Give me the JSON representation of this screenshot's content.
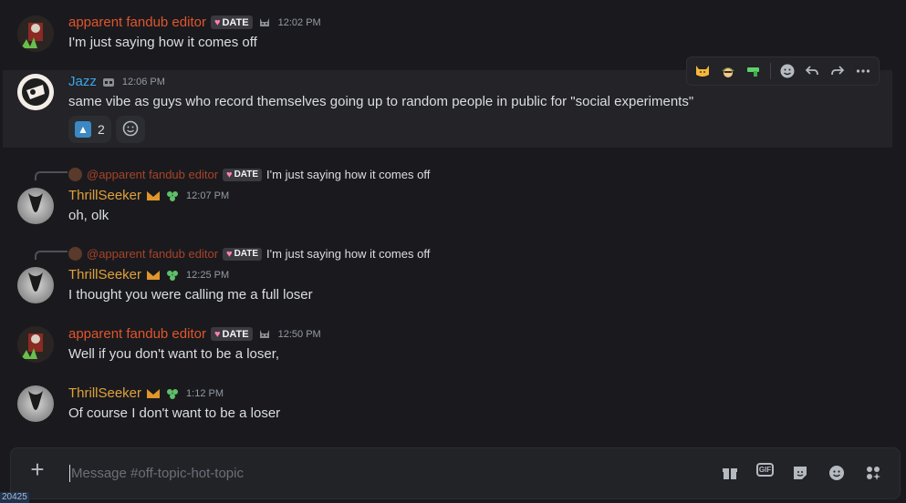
{
  "messages": [
    {
      "id": "m1",
      "author": "apparent fandub editor",
      "badge": "DATE",
      "time": "12:02 PM",
      "text": "I'm just saying how it comes off"
    },
    {
      "id": "m2",
      "author": "Jazz",
      "time": "12:06 PM",
      "text": "same vibe as guys who record themselves going up to random people in public for \"social experiments\"",
      "reactions": [
        {
          "emoji": "up-arrow-emoji",
          "count": "2"
        }
      ]
    },
    {
      "id": "m3",
      "reply": {
        "author": "@apparent fandub editor",
        "badge": "DATE",
        "text": "I'm just saying how it comes off"
      },
      "author": "ThrillSeeker",
      "time": "12:07 PM",
      "text": "oh, olk"
    },
    {
      "id": "m4",
      "reply": {
        "author": "@apparent fandub editor",
        "badge": "DATE",
        "text": "I'm just saying how it comes off"
      },
      "author": "ThrillSeeker",
      "time": "12:25 PM",
      "text": "I thought you were calling me a full loser"
    },
    {
      "id": "m5",
      "author": "apparent fandub editor",
      "badge": "DATE",
      "time": "12:50 PM",
      "text": "Well if you don't want to be a loser,"
    },
    {
      "id": "m6",
      "author": "ThrillSeeker",
      "time": "1:12 PM",
      "text": "Of course I don't want to be a loser"
    }
  ],
  "composer": {
    "placeholder": "Message #off-topic-hot-topic",
    "gif_label": "GIF"
  },
  "corner_label": "20425",
  "colors": {
    "editor_name": "#e0552b",
    "jazz_name": "#3aa7e6",
    "thrill_name": "#e0a13a",
    "background": "#1a1a1e"
  }
}
